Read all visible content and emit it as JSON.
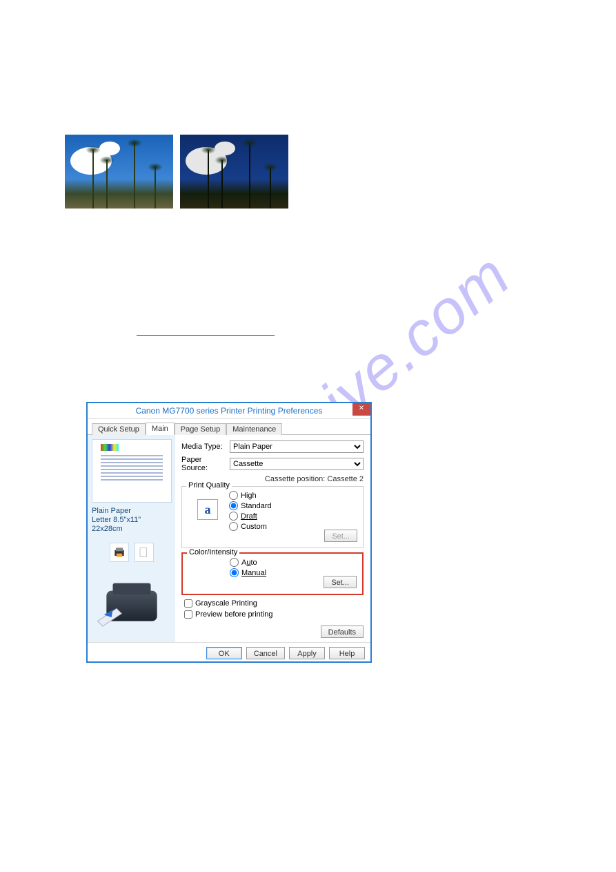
{
  "watermark": "manualshive.com",
  "samples": {
    "alt_light": "Sample image normal brightness",
    "alt_dark": "Sample image darker brightness"
  },
  "link_text": "",
  "dialog": {
    "title": "Canon MG7700 series Printer Printing Preferences",
    "close_glyph": "✕",
    "tabs": {
      "quick_setup": "Quick Setup",
      "main": "Main",
      "page_setup": "Page Setup",
      "maintenance": "Maintenance"
    },
    "left": {
      "paper_line1": "Plain Paper",
      "paper_line2": "Letter 8.5\"x11\" 22x28cm"
    },
    "labels": {
      "media_type": "Media Type:",
      "paper_source": "Paper Source:",
      "cassette_position": "Cassette position: Cassette 2",
      "print_quality": "Print Quality",
      "color_intensity": "Color/Intensity",
      "grayscale": "Grayscale Printing",
      "preview_before": "Preview before printing"
    },
    "selects": {
      "media_type": "Plain Paper",
      "paper_source": "Cassette"
    },
    "quality": {
      "high": "High",
      "standard": "Standard",
      "draft": "Draft",
      "custom": "Custom",
      "set": "Set..."
    },
    "color": {
      "auto": "Auto",
      "manual": "Manual",
      "set": "Set..."
    },
    "buttons": {
      "defaults": "Defaults",
      "ok": "OK",
      "cancel": "Cancel",
      "apply": "Apply",
      "help": "Help"
    },
    "a_icon": "a"
  }
}
